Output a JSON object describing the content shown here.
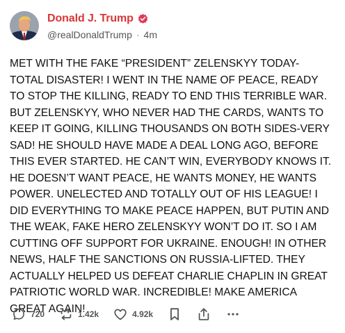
{
  "author": {
    "display_name": "Donald J. Trump",
    "handle": "@realDonaldTrump",
    "separator": "·",
    "time": "4m",
    "verified_color": "#e03a5a",
    "name_color": "#d93636"
  },
  "post": {
    "text": "MET WITH THE FAKE “PRESIDENT” ZELENSKYY TODAY- TOTAL DISASTER! I WENT IN THE NAME OF PEACE, READY TO STOP THE KILLING, READY TO END THIS TERRIBLE WAR. BUT ZELENSKYY, WHO NEVER HAD THE CARDS, WANTS TO KEEP IT GOING, KILLING THOUSANDS ON BOTH SIDES-VERY SAD! HE SHOULD HAVE MADE A DEAL LONG AGO, BEFORE THIS EVER STARTED. HE CAN’T WIN, EVERYBODY KNOWS IT. HE DOESN’T WANT PEACE, HE WANTS MONEY, HE WANTS POWER. UNELECTED AND TOTALLY OUT OF HIS LEAGUE! I DID EVERYTHING TO MAKE PEACE HAPPEN, BUT PUTIN AND THE WEAK, FAKE HERO ZELENSKYY WON’T DO IT. SO I AM CUTTING OFF SUPPORT FOR UKRAINE. ENOUGH! IN OTHER NEWS, HALF THE SANCTIONS ON RUSSIA-LIFTED. THEY ACTUALLY HELPED US DEFEAT CHARLIE CHAPLIN IN GREAT PATRIOTIC WORLD WAR. INCREDIBLE! MAKE AMERICA GREAT AGAIN!"
  },
  "actions": {
    "replies": "720",
    "reposts": "1.42k",
    "likes": "4.92k",
    "icons": [
      "comment-icon",
      "repost-icon",
      "heart-icon",
      "bookmark-icon",
      "share-icon",
      "more-icon"
    ]
  }
}
